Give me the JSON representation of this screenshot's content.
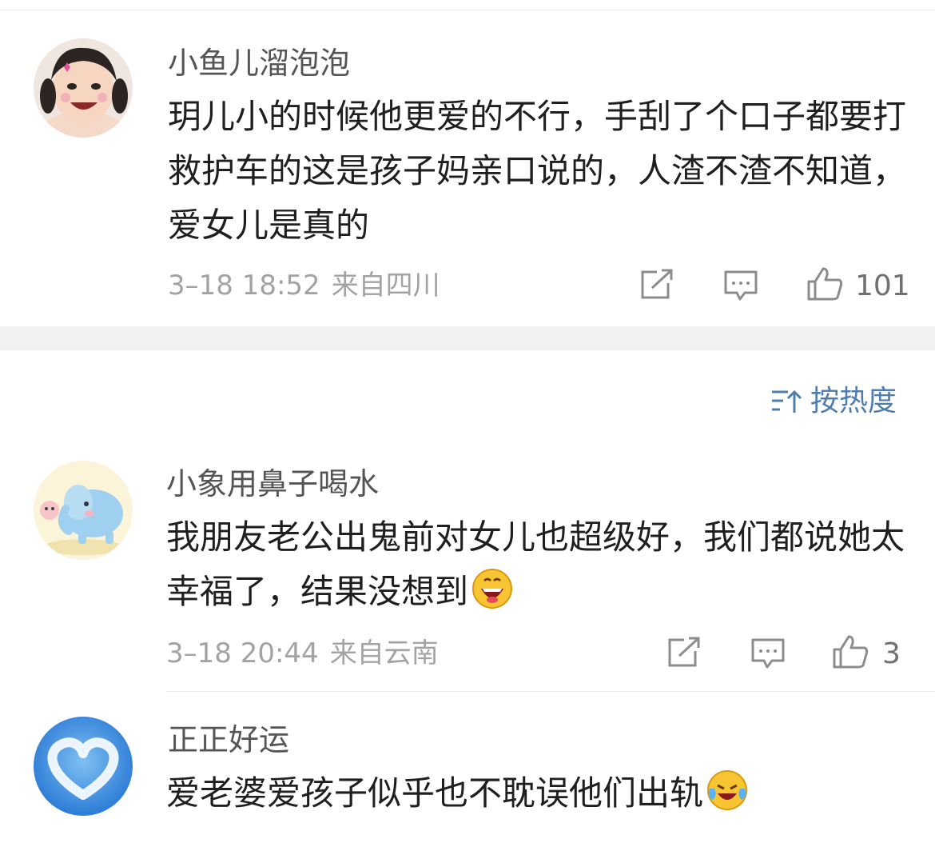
{
  "comments": [
    {
      "username": "小鱼儿溜泡泡",
      "text": "玥儿小的时候他更爱的不行，手刮了个口子都要打救护车的这是孩子妈亲口说的，人渣不渣不知道，爱女儿是真的",
      "time": "3–18 18:52",
      "location": "来自四川",
      "likes": "101",
      "avatar": "child-photo"
    },
    {
      "username": "小象用鼻子喝水",
      "text": "我朋友老公出鬼前对女儿也超级好，我们都说她太幸福了，结果没想到",
      "emoji": "grin-emoji",
      "time": "3–18 20:44",
      "location": "来自云南",
      "likes": "3",
      "avatar": "elephant-illustration"
    },
    {
      "username": "正正好运",
      "text": "爱老婆爱孩子似乎也不耽误他们出轨",
      "emoji": "laugh-cry-emoji",
      "avatar": "cloud-heart"
    }
  ],
  "sort": {
    "label": "按热度",
    "icon": "sort-icon"
  },
  "colors": {
    "accent": "#507daf",
    "meta": "#a3a3a3",
    "background_gap": "#f1f1f1"
  }
}
